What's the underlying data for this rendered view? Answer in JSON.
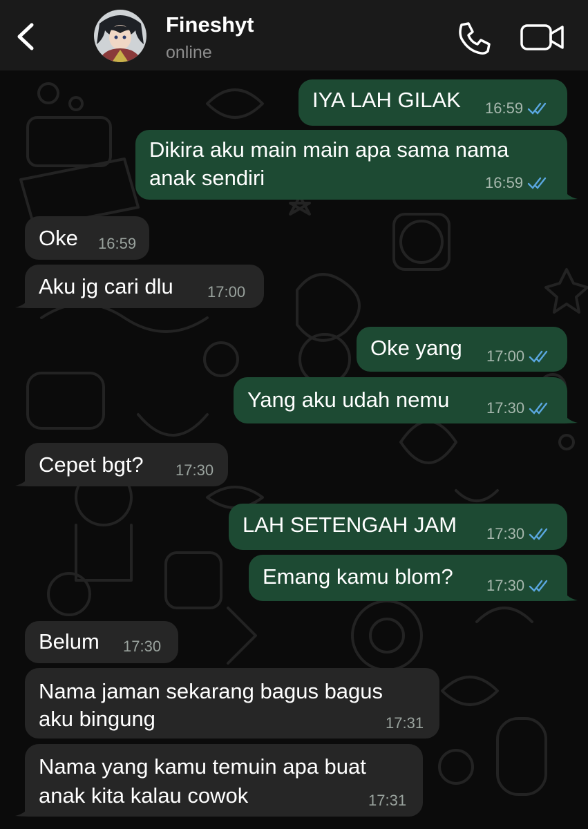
{
  "chat": {
    "contact_name": "Fineshyt",
    "status": "online"
  },
  "icons": {
    "back": "chevron-left-icon",
    "call": "phone-icon",
    "video": "video-camera-icon",
    "read": "double-check-icon"
  },
  "colors": {
    "header_bg": "#1a1a1a",
    "outgoing_bubble": "#1d4a33",
    "incoming_bubble": "#262626",
    "read_ticks": "#5aa7e0"
  },
  "messages": [
    {
      "direction": "out",
      "lines": [
        "IYA LAH GILAK"
      ],
      "time": "16:59",
      "read": true
    },
    {
      "direction": "out",
      "lines": [
        "Dikira aku main main apa sama nama",
        "anak sendiri"
      ],
      "time": "16:59",
      "read": true
    },
    {
      "direction": "in",
      "lines": [
        "Oke"
      ],
      "time": "16:59"
    },
    {
      "direction": "in",
      "lines": [
        "Aku jg cari dlu"
      ],
      "time": "17:00"
    },
    {
      "direction": "out",
      "lines": [
        "Oke yang"
      ],
      "time": "17:00",
      "read": true
    },
    {
      "direction": "out",
      "lines": [
        "Yang aku udah nemu"
      ],
      "time": "17:30",
      "read": true
    },
    {
      "direction": "in",
      "lines": [
        "Cepet bgt?"
      ],
      "time": "17:30"
    },
    {
      "direction": "out",
      "lines": [
        "LAH SETENGAH JAM"
      ],
      "time": "17:30",
      "read": true
    },
    {
      "direction": "out",
      "lines": [
        "Emang kamu blom?"
      ],
      "time": "17:30",
      "read": true
    },
    {
      "direction": "in",
      "lines": [
        "Belum"
      ],
      "time": "17:30"
    },
    {
      "direction": "in",
      "lines": [
        "Nama jaman sekarang bagus bagus",
        "aku bingung"
      ],
      "time": "17:31"
    },
    {
      "direction": "in",
      "lines": [
        "Nama yang kamu temuin apa buat",
        "anak kita kalau cowok"
      ],
      "time": "17:31"
    }
  ]
}
